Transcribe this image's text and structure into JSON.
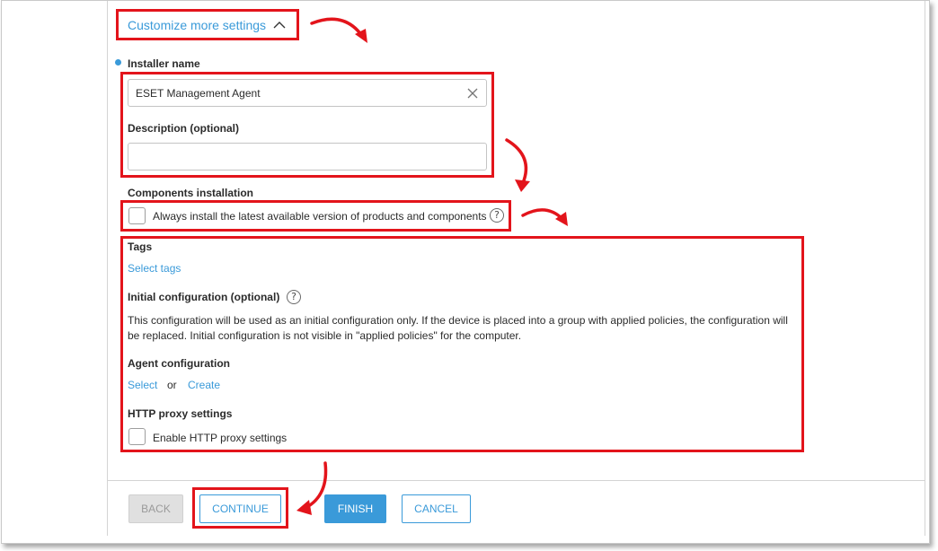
{
  "header": {
    "customize_toggle": "Customize more settings"
  },
  "form": {
    "installer_name_label": "Installer name",
    "installer_name_value": "ESET Management Agent",
    "description_label": "Description (optional)",
    "description_value": "",
    "components_label": "Components installation",
    "always_install_label": "Always install the latest available version of products and components",
    "tags_label": "Tags",
    "select_tags_link": "Select tags",
    "initial_config_label": "Initial configuration (optional)",
    "initial_config_text_1": "This configuration will be used as an initial configuration only. If the device is placed into a group with applied policies, the configuration will",
    "initial_config_text_2": "be replaced. Initial configuration is not visible in \"applied policies\" for the computer.",
    "agent_config_label": "Agent configuration",
    "select_link": "Select",
    "or_text": "or",
    "create_link": "Create",
    "proxy_label": "HTTP proxy settings",
    "enable_proxy_label": "Enable HTTP proxy settings"
  },
  "footer": {
    "back": "BACK",
    "continue": "CONTINUE",
    "finish": "FINISH",
    "cancel": "CANCEL"
  },
  "colors": {
    "accent": "#3a9ad9",
    "highlight": "#e3141b",
    "required_dot": "#3a9ad9"
  },
  "icons": {
    "toggle": "chevron-up-icon",
    "clear": "close-icon",
    "help": "question-circle-icon",
    "annotation": "curved-arrow-icon"
  }
}
